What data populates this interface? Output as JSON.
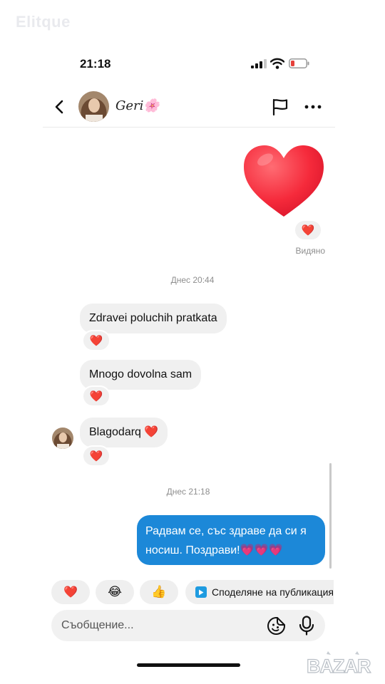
{
  "watermark": "Elitque",
  "status_bar": {
    "time": "21:18",
    "battery_color": "#e5403a"
  },
  "header": {
    "contact_name": "Geri🌸",
    "back_icon": "chevron-left-icon",
    "flag_icon": "flag-icon",
    "more_icon": "more-horizontal-icon"
  },
  "messages": {
    "sent_heart_reaction": "❤️",
    "seen_label": "Видяно",
    "date_separator_1": "Днес 20:44",
    "incoming": [
      {
        "text": "Zdravei poluchih pratkata",
        "reaction": "❤️"
      },
      {
        "text": "Mnogo dovolna sam",
        "reaction": "❤️"
      },
      {
        "text": "Blagodarq ❤️",
        "reaction": "❤️"
      }
    ],
    "date_separator_2": "Днес 21:18",
    "outgoing_text": "Радвам се, със здраве да си я носиш. Поздрави!💗💗💗",
    "outgoing_color": "#1c88d8"
  },
  "quick_replies": {
    "heart": "❤️",
    "laugh": "😂",
    "thumbs_up": "👍",
    "share_label": "Споделяне на публикация"
  },
  "composer": {
    "placeholder": "Съобщение..."
  },
  "logo": {
    "text": "BAZAR"
  }
}
